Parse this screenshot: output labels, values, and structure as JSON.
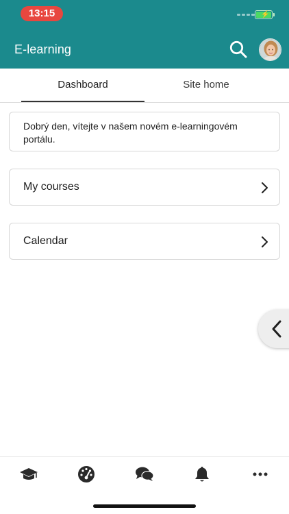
{
  "status_bar": {
    "time": "13:15"
  },
  "header": {
    "title": "E-learning"
  },
  "tabs": [
    {
      "label": "Dashboard",
      "active": true
    },
    {
      "label": "Site home",
      "active": false
    }
  ],
  "welcome": {
    "text": "Dobrý den, vítejte v našem novém e-learningovém portálu."
  },
  "links": [
    {
      "label": "My courses"
    },
    {
      "label": "Calendar"
    }
  ],
  "bottom_nav": {
    "items": [
      {
        "icon": "graduation-cap-icon"
      },
      {
        "icon": "dashboard-gauge-icon"
      },
      {
        "icon": "messages-icon"
      },
      {
        "icon": "bell-icon"
      },
      {
        "icon": "more-icon"
      }
    ]
  },
  "colors": {
    "header": "#1b8a8d",
    "time_pill": "#e8473f",
    "battery": "#4cd964"
  }
}
